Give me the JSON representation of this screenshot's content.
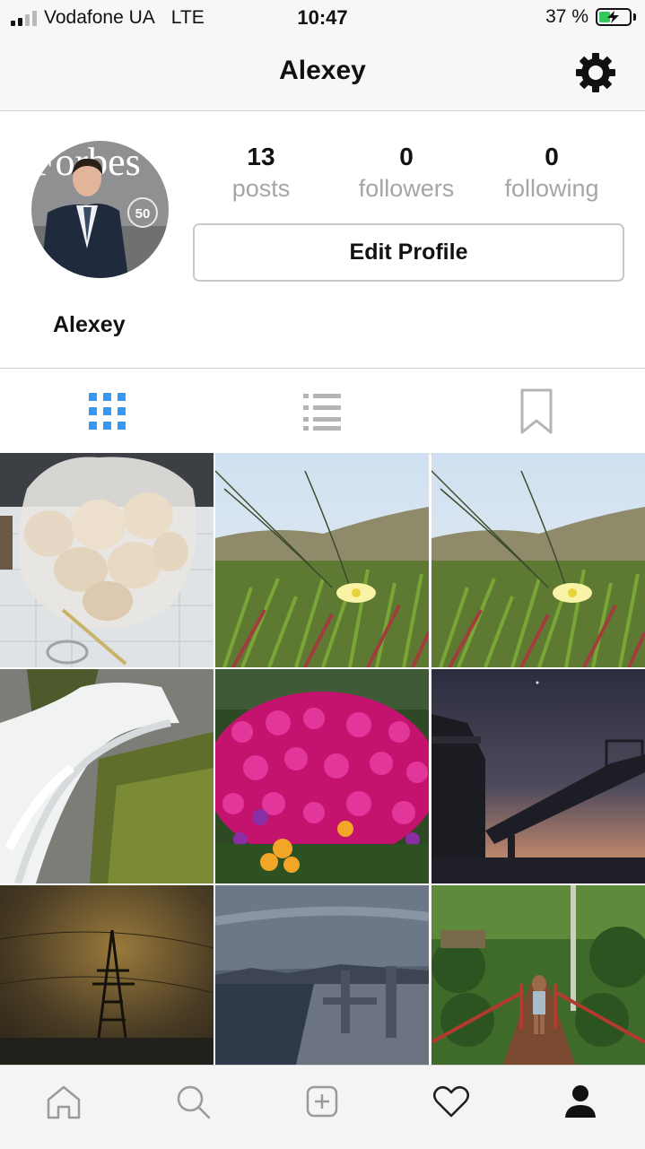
{
  "status_bar": {
    "carrier": "Vodafone UA",
    "network": "LTE",
    "time": "10:47",
    "battery_percent": "37 %",
    "battery_level": 0.37,
    "signal_bars": 2
  },
  "nav": {
    "title": "Alexey",
    "settings_icon": "gear-icon"
  },
  "profile": {
    "name": "Alexey",
    "avatar_text": "Forbes",
    "avatar_badge": "50",
    "stats": [
      {
        "value": "13",
        "label": "posts"
      },
      {
        "value": "0",
        "label": "followers"
      },
      {
        "value": "0",
        "label": "following"
      }
    ],
    "edit_label": "Edit Profile"
  },
  "tabs": [
    {
      "icon": "grid-icon",
      "active": true
    },
    {
      "icon": "list-icon",
      "active": false
    },
    {
      "icon": "bookmark-icon",
      "active": false
    }
  ],
  "posts": [
    {
      "subject": "mushrooms-bag"
    },
    {
      "subject": "grass-flower"
    },
    {
      "subject": "grass-flower"
    },
    {
      "subject": "waterfall"
    },
    {
      "subject": "pink-flowers"
    },
    {
      "subject": "crane-sunset"
    },
    {
      "subject": "power-tower"
    },
    {
      "subject": "sea-tanker"
    },
    {
      "subject": "jungle-bridge"
    }
  ],
  "bottom_nav": [
    {
      "icon": "home-icon"
    },
    {
      "icon": "search-icon"
    },
    {
      "icon": "add-post-icon"
    },
    {
      "icon": "heart-icon"
    },
    {
      "icon": "profile-icon",
      "active": true
    }
  ],
  "colors": {
    "accent_blue": "#3897f0",
    "battery_green": "#34c759",
    "muted_text": "#a6a6a6"
  }
}
